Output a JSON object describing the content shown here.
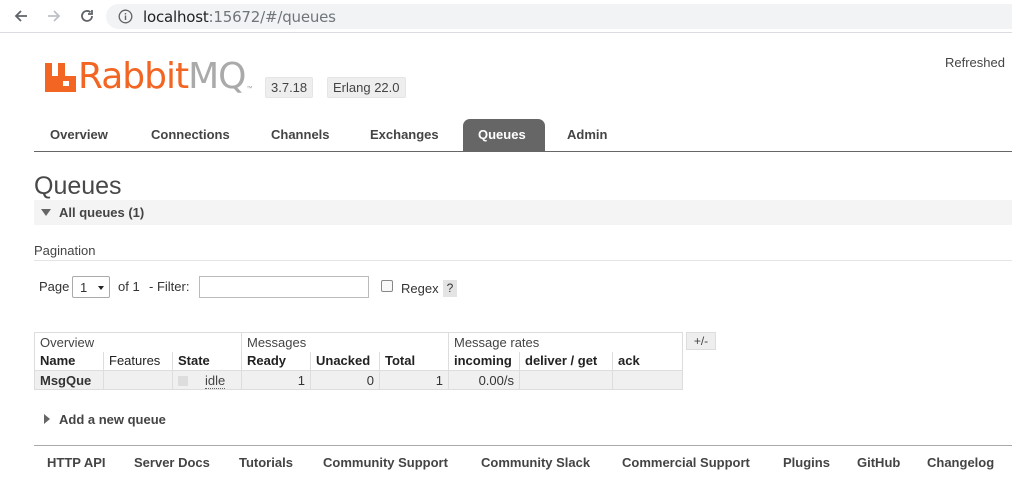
{
  "browser": {
    "url_host": "localhost",
    "url_rest": ":15672/#/queues"
  },
  "header": {
    "logo_rabbit": "Rabbit",
    "logo_mq": "MQ",
    "logo_tm": "™",
    "version": "3.7.18",
    "erlang": "Erlang 22.0",
    "refreshed": "Refreshed"
  },
  "tabs": [
    {
      "label": "Overview",
      "active": false
    },
    {
      "label": "Connections",
      "active": false
    },
    {
      "label": "Channels",
      "active": false
    },
    {
      "label": "Exchanges",
      "active": false
    },
    {
      "label": "Queues",
      "active": true
    },
    {
      "label": "Admin",
      "active": false
    }
  ],
  "page": {
    "title": "Queues",
    "section": "All queues (1)",
    "pagination_label": "Pagination"
  },
  "pager": {
    "page_label": "Page",
    "page_value": "1",
    "of_label": "of 1",
    "filter_label": "- Filter:",
    "filter_value": "",
    "regex_label": "Regex",
    "help": "?"
  },
  "table": {
    "groups": [
      "Overview",
      "Messages",
      "Message rates"
    ],
    "columns": [
      "Name",
      "Features",
      "State",
      "Ready",
      "Unacked",
      "Total",
      "incoming",
      "deliver / get",
      "ack"
    ],
    "rows": [
      {
        "name": "MsgQue",
        "features": "",
        "state": "idle",
        "ready": "1",
        "unacked": "0",
        "total": "1",
        "incoming": "0.00/s",
        "deliver_get": "",
        "ack": ""
      }
    ],
    "toggle": "+/-"
  },
  "add_queue": "Add a new queue",
  "footer": [
    "HTTP API",
    "Server Docs",
    "Tutorials",
    "Community Support",
    "Community Slack",
    "Commercial Support",
    "Plugins",
    "GitHub",
    "Changelog"
  ],
  "colors": {
    "brand_orange": "#f26522",
    "active_tab": "#666666"
  }
}
